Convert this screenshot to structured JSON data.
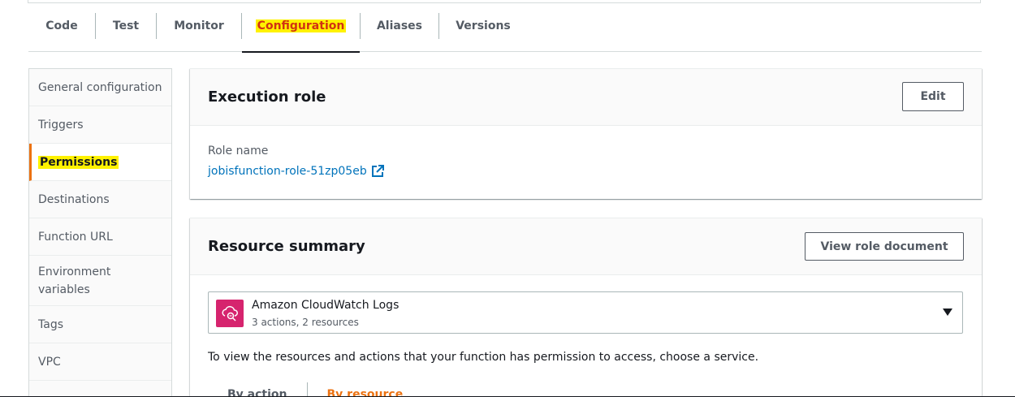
{
  "tabs": [
    {
      "label": "Code"
    },
    {
      "label": "Test"
    },
    {
      "label": "Monitor"
    },
    {
      "label": "Configuration"
    },
    {
      "label": "Aliases"
    },
    {
      "label": "Versions"
    }
  ],
  "sidebar": {
    "items": [
      {
        "label": "General configuration"
      },
      {
        "label": "Triggers"
      },
      {
        "label": "Permissions"
      },
      {
        "label": "Destinations"
      },
      {
        "label": "Function URL"
      },
      {
        "label": "Environment variables"
      },
      {
        "label": "Tags"
      },
      {
        "label": "VPC"
      }
    ]
  },
  "execution_role": {
    "title": "Execution role",
    "edit_label": "Edit",
    "role_name_label": "Role name",
    "role_name": "jobisfunction-role-51zp05eb"
  },
  "resource_summary": {
    "title": "Resource summary",
    "view_doc_label": "View role document",
    "service_name": "Amazon CloudWatch Logs",
    "service_detail": "3 actions, 2 resources",
    "description": "To view the resources and actions that your function has permission to access, choose a service.",
    "subtabs": [
      {
        "label": "By action"
      },
      {
        "label": "By resource"
      }
    ]
  },
  "colors": {
    "accent": "#ec7211",
    "link": "#0073bb",
    "highlight": "#fff200",
    "cloudwatch_icon": "#d6246e"
  },
  "icons": {
    "external_link": "external-link-icon",
    "service": "cloudwatch-logs-icon",
    "dropdown": "caret-down-icon"
  }
}
